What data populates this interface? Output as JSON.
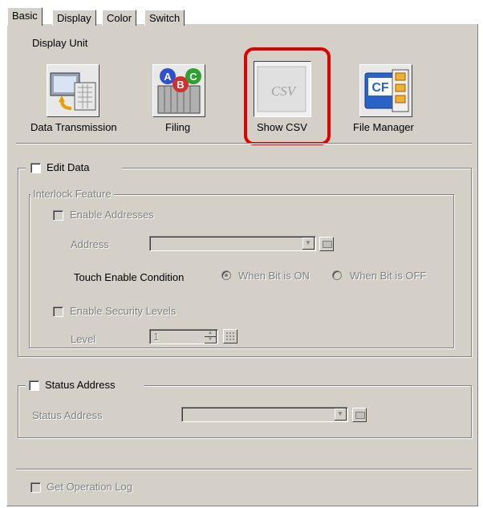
{
  "tabs": [
    {
      "label": "Basic",
      "active": true
    },
    {
      "label": "Display",
      "active": false
    },
    {
      "label": "Color",
      "active": false
    },
    {
      "label": "Switch",
      "active": false
    }
  ],
  "display_unit": {
    "heading": "Display Unit",
    "items": [
      {
        "label": "Data Transmission",
        "icon": "data-transmission-icon"
      },
      {
        "label": "Filing",
        "icon": "filing-abc-icon"
      },
      {
        "label": "Show CSV",
        "icon": "csv-icon",
        "icon_text": "CSV",
        "selected": true
      },
      {
        "label": "File Manager",
        "icon": "cf-card-folder-icon",
        "icon_text": "CF"
      }
    ]
  },
  "edit_data": {
    "label": "Edit Data",
    "checked": false,
    "interlock": {
      "legend": "Interlock Feature",
      "enable_addresses_label": "Enable Addresses",
      "address_label": "Address",
      "address_value": "",
      "touch_condition_label": "Touch Enable Condition",
      "when_on_label": "When Bit is ON",
      "when_off_label": "When Bit is OFF",
      "selected_condition": "on",
      "enable_security_label": "Enable Security Levels",
      "level_label": "Level",
      "level_value": "1"
    }
  },
  "status_address": {
    "checkbox_label": "Status Address",
    "field_label": "Status Address",
    "value": ""
  },
  "get_operation_log": {
    "label": "Get Operation Log",
    "checked": false
  },
  "colors": {
    "highlight": "#e00000",
    "panel": "#d4d0c8",
    "disabled_text": "#808080"
  }
}
